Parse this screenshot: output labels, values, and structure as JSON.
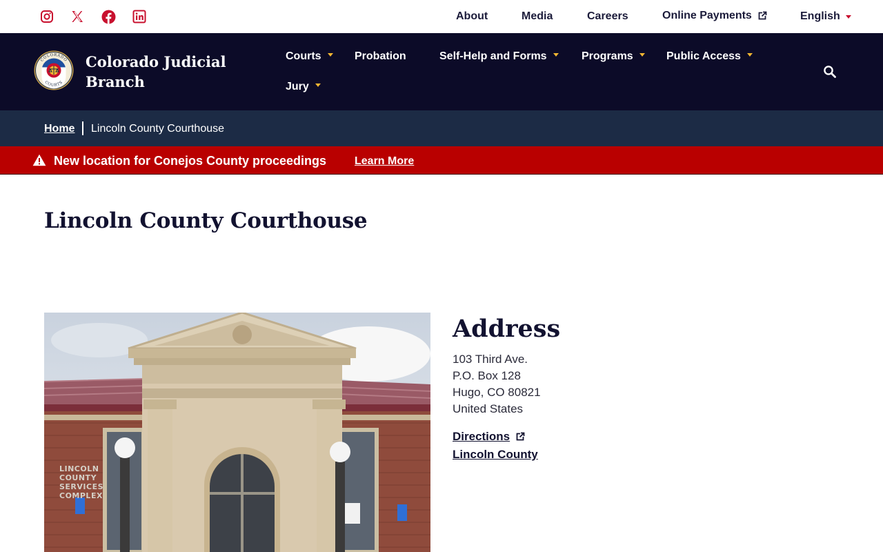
{
  "social": [
    {
      "name": "instagram-icon",
      "color": "#c8102e"
    },
    {
      "name": "x-twitter-icon",
      "color": "#c8102e"
    },
    {
      "name": "facebook-icon",
      "color": "#c8102e"
    },
    {
      "name": "linkedin-icon",
      "color": "#c8102e"
    }
  ],
  "utility_nav": {
    "about": "About",
    "media": "Media",
    "careers": "Careers",
    "online_payments": "Online Payments",
    "language": "English"
  },
  "brand": {
    "name": "Colorado Judicial Branch",
    "seal_top_text": "COLORADO",
    "seal_bottom_text": "COURTS"
  },
  "main_nav": {
    "courts": "Courts",
    "probation": "Probation",
    "self_help": "Self-Help and Forms",
    "programs": "Programs",
    "public_access": "Public Access",
    "jury": "Jury"
  },
  "breadcrumb": {
    "home": "Home",
    "current": "Lincoln County Courthouse"
  },
  "alert": {
    "message": "New location for Conejos County proceedings",
    "link_label": "Learn More"
  },
  "page": {
    "title": "Lincoln County Courthouse"
  },
  "photo": {
    "sign_lines": [
      "LINCOLN",
      "COUNTY",
      "SERVICES",
      "COMPLEX"
    ]
  },
  "address": {
    "heading": "Address",
    "line1": "103 Third Ave.",
    "line2": "P.O. Box 128",
    "line3": "Hugo, CO 80821",
    "line4": "United States",
    "directions_label": "Directions",
    "county_label": "Lincoln County"
  },
  "colors": {
    "header_bg": "#0c0b28",
    "breadcrumb_bg": "#1c2b45",
    "alert_bg": "#b90000",
    "accent_red": "#c8102e",
    "caret_gold": "#f2b632"
  }
}
